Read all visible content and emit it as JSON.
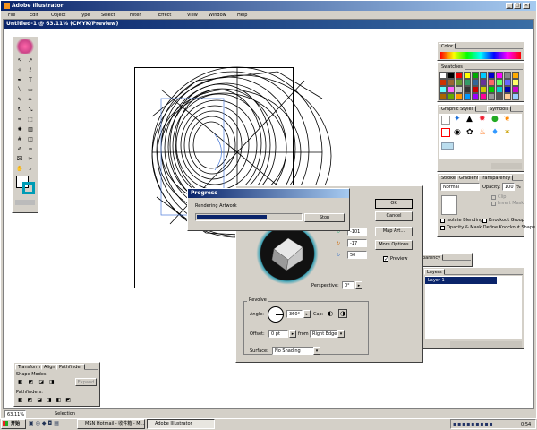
{
  "app": {
    "title": "Adobe Illustrator"
  },
  "menu": [
    "File",
    "Edit",
    "Object",
    "Type",
    "Select",
    "Filter",
    "Effect",
    "View",
    "Window",
    "Help"
  ],
  "document": {
    "title": "Untitled-1 @ 63.11% (CMYK/Preview)"
  },
  "status": {
    "zoom": "63.11%",
    "tool_readout": "Selection"
  },
  "panels": {
    "color": {
      "tab": "Color"
    },
    "swatches": {
      "tab": "Swatches"
    },
    "graphic_styles": {
      "tab1": "Graphic Styles",
      "tab2": "Symbols"
    },
    "stroke": {
      "tab1": "Stroke",
      "tab2": "Gradient",
      "tab3": "Transparency",
      "blend_mode": "Normal",
      "opacity_label": "Opacity:",
      "opacity_value": "100",
      "opacity_unit": "%",
      "clip": "Clip",
      "invert_mask": "Invert Mask",
      "isolate_blending": "Isolate Blending",
      "knockout_group": "Knockout Group",
      "opacity_mask": "Opacity & Mask Define Knockout Shape"
    },
    "layers": {
      "tab": "Layers",
      "layer_name": "Layer 1",
      "ghost_tab": "parency"
    },
    "pathfinder": {
      "tab1": "Transform",
      "tab2": "Align",
      "tab3": "Pathfinder",
      "shape_modes": "Shape Modes:",
      "expand": "Expand",
      "pathfinders": "Pathfinders:"
    }
  },
  "progress": {
    "title": "Progress",
    "message": "Rendering Artwork",
    "stop": "Stop",
    "fraction": 0.67
  },
  "revolve_dialog": {
    "ok": "OK",
    "cancel": "Cancel",
    "map_art": "Map Art...",
    "more_options": "More Options",
    "preview": "Preview",
    "rot_x": "-101",
    "rot_y": "-17",
    "rot_z": "50",
    "perspective_label": "Perspective:",
    "perspective_value": "0°",
    "revolve_group": "Revolve",
    "angle_label": "Angle:",
    "angle_value": "360°",
    "cap_label": "Cap:",
    "offset_label": "Offset:",
    "offset_value": "0 pt",
    "from_label": "from",
    "from_value": "Right Edge",
    "surface_label": "Surface:",
    "surface_value": "No Shading"
  },
  "taskbar": {
    "start": "开始",
    "tasks": [
      "MSN Hotmail - 收件箱 - M...",
      "Adobe Illustrator"
    ],
    "clock": "0:54"
  }
}
